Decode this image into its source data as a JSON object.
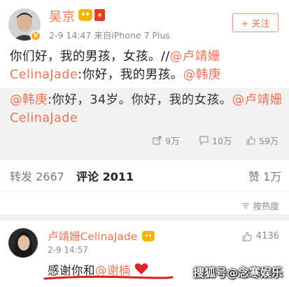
{
  "post": {
    "username": "吴京",
    "vip_icon": "crown-vip-icon",
    "verified_badge": "V",
    "date": "2-9 14:47",
    "source": "来自iPhone 7 Plus",
    "follow_label": "+ 关注",
    "text_plain_1": "你们好，我的男孩，女孩。//",
    "mention_1": "@卢靖姗CelinaJade",
    "text_plain_2": ":你好，我的男孩。",
    "mention_2": "@韩庚"
  },
  "repost": {
    "mention_1": "@韩庚",
    "text_plain_1": ":你好，34岁。你好，我的女孩。",
    "mention_2": "@卢靖姗CelinaJade",
    "stats": {
      "share": "9万",
      "comment": "10万",
      "like": "59万"
    }
  },
  "tabs": {
    "repost_label": "转发",
    "repost_count": "2667",
    "comment_label": "评论",
    "comment_count": "2011",
    "like_label": "赞",
    "like_count": "1万"
  },
  "sort": {
    "label": "按热度"
  },
  "comment": {
    "username": "卢靖姗CelinaJade",
    "time": "2-9 14:57",
    "likes": "4136",
    "text_plain": "感谢你和",
    "mention": "@谢楠"
  },
  "watermark": {
    "text": "搜狐号@念寒娱乐"
  },
  "colors": {
    "accent": "#eb7350",
    "repost_bg": "#f2f2f2",
    "heart": "#e0242b",
    "underline": "#d81e1e"
  }
}
